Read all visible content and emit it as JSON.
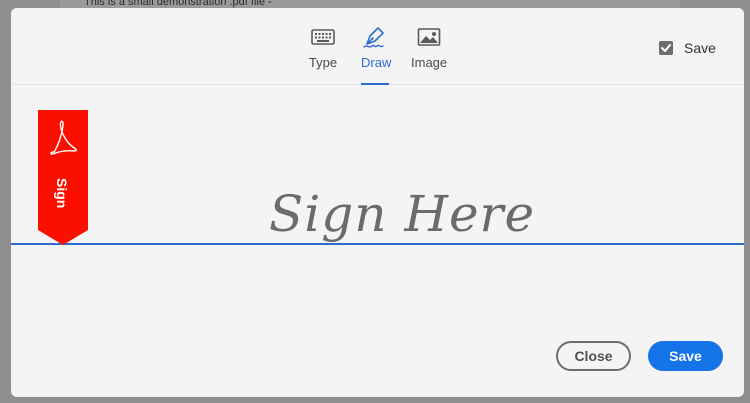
{
  "background": {
    "doc_text": "This is a small demonstration .pdf file -"
  },
  "tabs": [
    {
      "label": "Type",
      "icon": "keyboard-icon",
      "active": false
    },
    {
      "label": "Draw",
      "icon": "pen-icon",
      "active": true
    },
    {
      "label": "Image",
      "icon": "image-icon",
      "active": false
    }
  ],
  "save_toggle": {
    "label": "Save",
    "checked": true
  },
  "signature": {
    "flag_label": "Sign",
    "placeholder": "Sign Here"
  },
  "buttons": {
    "close": "Close",
    "save": "Save"
  },
  "colors": {
    "accent": "#2c6cd0",
    "primary_button": "#1473e6",
    "flag": "#fa0f00"
  }
}
